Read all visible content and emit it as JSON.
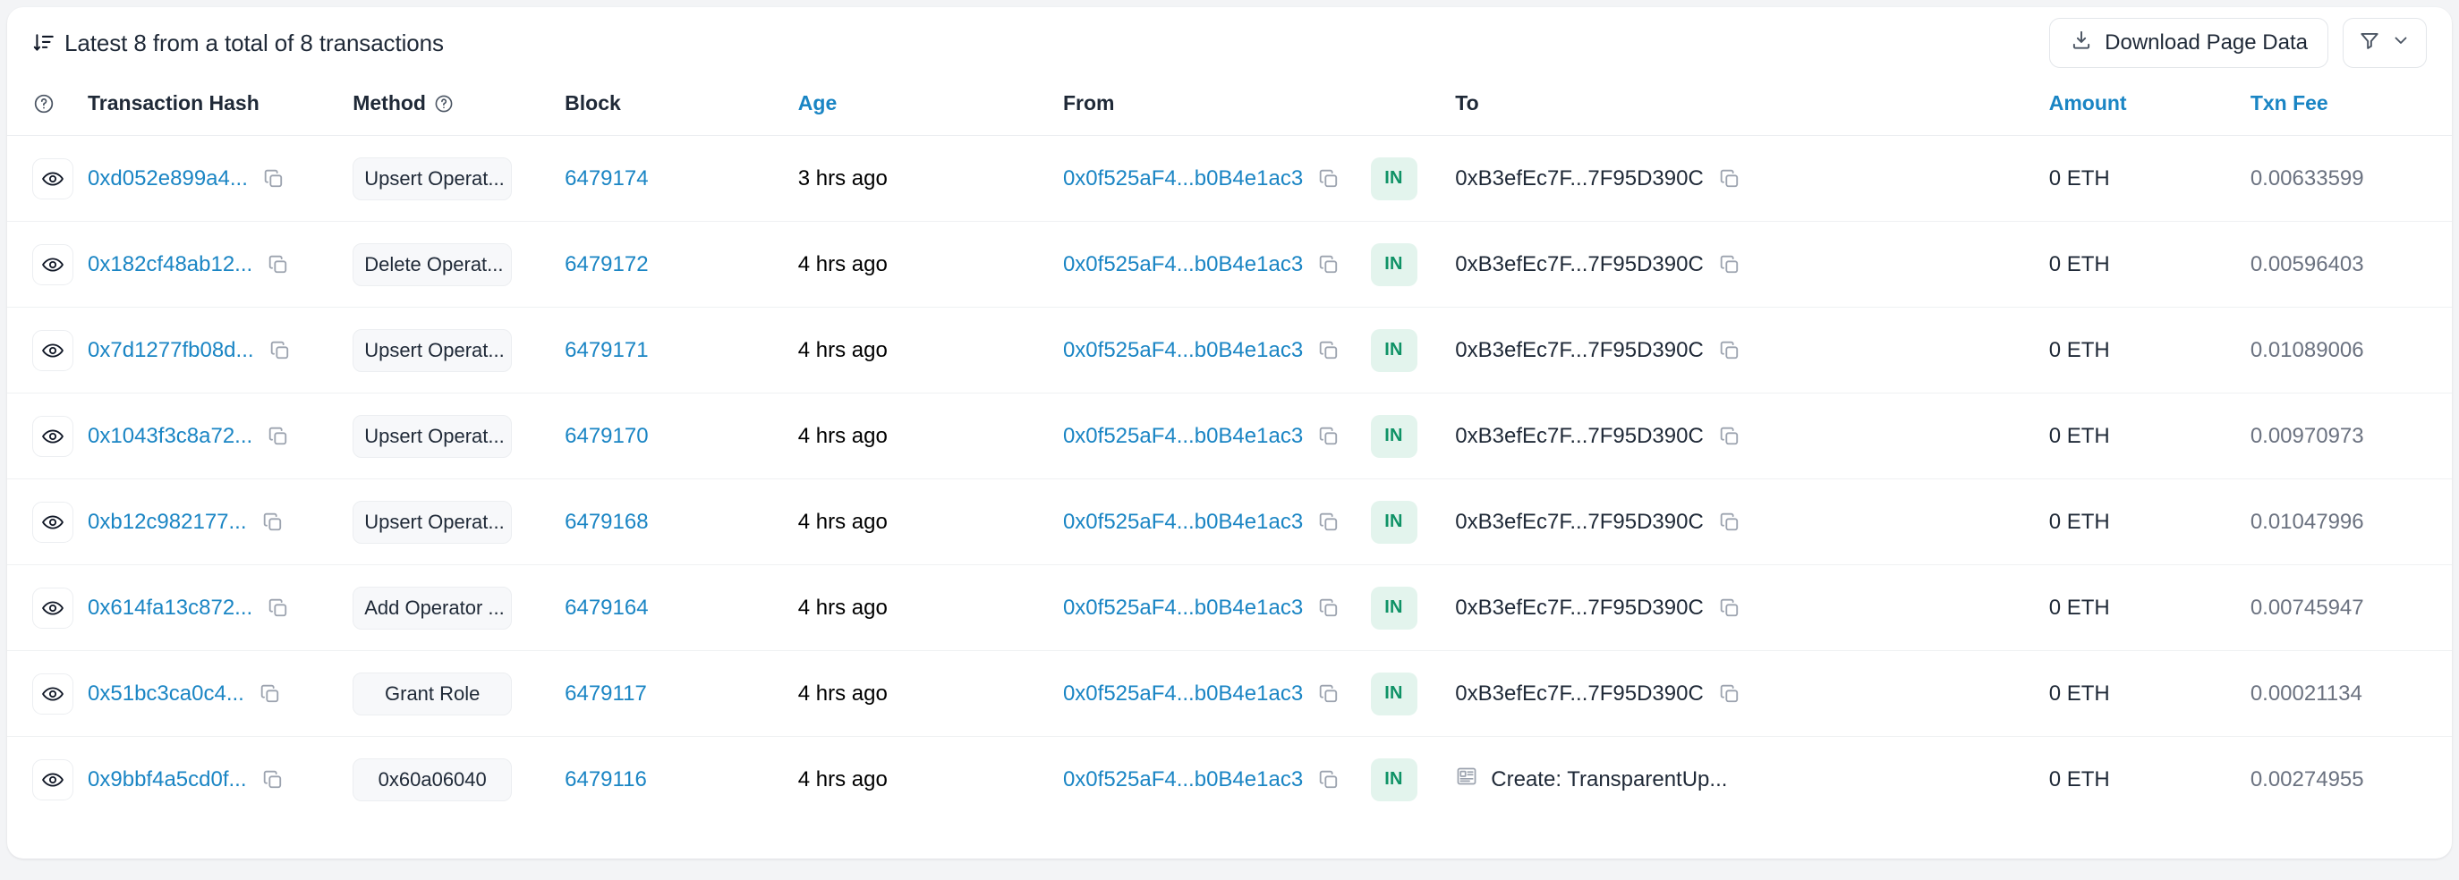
{
  "header": {
    "summary_text": "Latest 8 from a total of 8 transactions",
    "sort_icon": "sort-descending-icon",
    "download_button": {
      "label": "Download Page Data",
      "icon": "download-icon"
    },
    "filter_button": {
      "icon": "funnel-icon",
      "chevron_icon": "chevron-down-icon"
    }
  },
  "table": {
    "columns": [
      {
        "key": "help",
        "label": "",
        "icon": "question-circle-icon",
        "is_link": false
      },
      {
        "key": "hash",
        "label": "Transaction Hash",
        "is_link": false
      },
      {
        "key": "method",
        "label": "Method",
        "icon": "question-circle-icon",
        "is_link": false
      },
      {
        "key": "block",
        "label": "Block",
        "is_link": false
      },
      {
        "key": "age",
        "label": "Age",
        "is_link": true
      },
      {
        "key": "from",
        "label": "From",
        "is_link": false
      },
      {
        "key": "inout",
        "label": "",
        "is_link": false
      },
      {
        "key": "to",
        "label": "To",
        "is_link": false
      },
      {
        "key": "amount",
        "label": "Amount",
        "is_link": true
      },
      {
        "key": "fee",
        "label": "Txn Fee",
        "is_link": true
      }
    ],
    "rows": [
      {
        "hash": "0xd052e899a4...",
        "method": "Upsert Operat...",
        "method_centered": false,
        "block": "6479174",
        "age": "3 hrs ago",
        "from": "0x0f525aF4...b0B4e1ac3",
        "direction": "IN",
        "to": "0xB3efEc7F...7F95D390C",
        "to_is_contract_create": false,
        "to_has_copy": true,
        "amount": "0 ETH",
        "fee": "0.00633599"
      },
      {
        "hash": "0x182cf48ab12...",
        "method": "Delete Operat...",
        "method_centered": false,
        "block": "6479172",
        "age": "4 hrs ago",
        "from": "0x0f525aF4...b0B4e1ac3",
        "direction": "IN",
        "to": "0xB3efEc7F...7F95D390C",
        "to_is_contract_create": false,
        "to_has_copy": true,
        "amount": "0 ETH",
        "fee": "0.00596403"
      },
      {
        "hash": "0x7d1277fb08d...",
        "method": "Upsert Operat...",
        "method_centered": false,
        "block": "6479171",
        "age": "4 hrs ago",
        "from": "0x0f525aF4...b0B4e1ac3",
        "direction": "IN",
        "to": "0xB3efEc7F...7F95D390C",
        "to_is_contract_create": false,
        "to_has_copy": true,
        "amount": "0 ETH",
        "fee": "0.01089006"
      },
      {
        "hash": "0x1043f3c8a72...",
        "method": "Upsert Operat...",
        "method_centered": false,
        "block": "6479170",
        "age": "4 hrs ago",
        "from": "0x0f525aF4...b0B4e1ac3",
        "direction": "IN",
        "to": "0xB3efEc7F...7F95D390C",
        "to_is_contract_create": false,
        "to_has_copy": true,
        "amount": "0 ETH",
        "fee": "0.00970973"
      },
      {
        "hash": "0xb12c982177...",
        "method": "Upsert Operat...",
        "method_centered": false,
        "block": "6479168",
        "age": "4 hrs ago",
        "from": "0x0f525aF4...b0B4e1ac3",
        "direction": "IN",
        "to": "0xB3efEc7F...7F95D390C",
        "to_is_contract_create": false,
        "to_has_copy": true,
        "amount": "0 ETH",
        "fee": "0.01047996"
      },
      {
        "hash": "0x614fa13c872...",
        "method": "Add Operator ...",
        "method_centered": false,
        "block": "6479164",
        "age": "4 hrs ago",
        "from": "0x0f525aF4...b0B4e1ac3",
        "direction": "IN",
        "to": "0xB3efEc7F...7F95D390C",
        "to_is_contract_create": false,
        "to_has_copy": true,
        "amount": "0 ETH",
        "fee": "0.00745947"
      },
      {
        "hash": "0x51bc3ca0c4...",
        "method": "Grant Role",
        "method_centered": true,
        "block": "6479117",
        "age": "4 hrs ago",
        "from": "0x0f525aF4...b0B4e1ac3",
        "direction": "IN",
        "to": "0xB3efEc7F...7F95D390C",
        "to_is_contract_create": false,
        "to_has_copy": true,
        "amount": "0 ETH",
        "fee": "0.00021134"
      },
      {
        "hash": "0x9bbf4a5cd0f...",
        "method": "0x60a06040",
        "method_centered": true,
        "block": "6479116",
        "age": "4 hrs ago",
        "from": "0x0f525aF4...b0B4e1ac3",
        "direction": "IN",
        "to": "Create: TransparentUp...",
        "to_is_contract_create": true,
        "to_has_copy": false,
        "amount": "0 ETH",
        "fee": "0.00274955"
      }
    ]
  },
  "colors": {
    "link": "#1a85c4",
    "badge_bg": "#e3f4ed",
    "badge_text": "#0f9266",
    "text_primary": "#1f2937",
    "text_muted": "#6b7280",
    "card_bg": "#ffffff",
    "page_bg": "#f3f4f6"
  }
}
